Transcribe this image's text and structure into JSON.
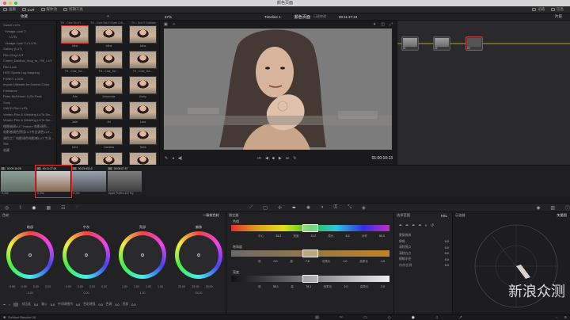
{
  "window_title": "颜色页面",
  "toolbar": {
    "left": [
      "media_label_1",
      "media_label_2",
      "media_label_3",
      "media_label_4"
    ],
    "left_labels": [
      "画廊",
      "LUT",
      "媒体池",
      "剪辑工具"
    ],
    "right_labels": [
      "光箱",
      "信息"
    ]
  },
  "subbar": {
    "media_tree_title": "收藏",
    "zoom": "27%",
    "timeline_name": "Timeline 1",
    "page_title": "颜色页面",
    "page_subtitle": "已经修改",
    "timecode": "00:11:27:24",
    "node_label": "片段"
  },
  "media_tree": [
    "Sweet LUTs",
    "Vintage Look 2",
    "LUTs",
    "Vintage Look 2.2 LUTs",
    "Gallery (LUT)",
    "Film-Vlog LUT",
    "Cinem_DaVinci_Vlog_to_709_LUT",
    "Film Look",
    "HGH Sports Log Mapping",
    "FUNKY LOOK",
    "Impulz Ultimate for Davinci Color",
    "Freelance",
    "Peter McKinnon LUTs Pack",
    "Sony",
    "VMCD Film LUTs",
    "Vimbro Film & Wedding LUTs Ser...",
    "Vimbro Film & Wedding LUTs Ser...",
    "夜晚暗调LUT Yeaven 电影调色...",
    "电影感调色预设LUT专业调色LUT...",
    "调色工厂电影调色电影感LUT 专业...",
    "Site",
    "收藏"
  ],
  "media_grid": {
    "headers": [
      "TH - Cine Sci-Fi ...",
      "TH - Cine Sci-Fi Dark Crit...",
      "TH - Sci-Fi Gotham"
    ],
    "thumbs": [
      "Alina",
      "Alina",
      "Alina",
      "TH - Cine_Sci ...",
      "TH - Cine_Sci ...",
      "TH - Cine_Sci ...",
      "Ada",
      "Anacronia",
      "Avery",
      "Jade",
      "Jet",
      "Lara",
      "Lima",
      "Carolina",
      "Tarek",
      "Fall 80s - Sweet Faded",
      "Ruben",
      "Kaipa"
    ]
  },
  "viewer": {
    "timecode": "01:00:10:13"
  },
  "nodes": [
    "01",
    "02",
    "03"
  ],
  "timeline": {
    "clips": [
      {
        "num": "01",
        "tc": "00:09:16:25",
        "name": "H.264"
      },
      {
        "num": "02",
        "tc": "00:11:27:24",
        "name": "H.264"
      },
      {
        "num": "03",
        "tc": "00:23:43:10",
        "name": "H.264"
      },
      {
        "num": "04",
        "tc": "00:05:07:07",
        "name": "Apple ProRes 422 HQ"
      }
    ]
  },
  "wheels": {
    "panel_title": "色轮",
    "mode_label": "一级校色轮",
    "items": [
      {
        "label": "暗部",
        "values": [
          "0.00",
          "0.00",
          "0.00",
          "0.00"
        ],
        "sub": "-0.00"
      },
      {
        "label": "中灰",
        "values": [
          "0.00",
          "0.00",
          "0.00",
          "0.00"
        ],
        "sub": "0.00"
      },
      {
        "label": "亮部",
        "values": [
          "1.00",
          "1.00",
          "1.00",
          "1.00"
        ],
        "sub": "1.00"
      },
      {
        "label": "偏移",
        "values": [
          "25.00",
          "25.00",
          "25.00",
          ""
        ],
        "sub": "25.00"
      }
    ],
    "footer": [
      "对比度",
      "0.0",
      "轴心",
      "0.0",
      "中间调细节",
      "0.0",
      "色彩增强",
      "0.0",
      "色调",
      "0.0",
      "亮部",
      "0.0"
    ]
  },
  "hsl": {
    "panel_title": "限定器",
    "bars": [
      {
        "label": "色相",
        "vals": [
          "中心",
          "35.2",
          "宽度",
          "11.2",
          "柔化",
          "6.2",
          "对称",
          "50.0"
        ],
        "colors": [
          "#e03030",
          "#e0a020",
          "#e0e020",
          "#30c030",
          "#30c0e0",
          "#3030e0",
          "#c030c0"
        ]
      },
      {
        "label": "饱和度",
        "vals": [
          "低",
          "0.0",
          "高",
          "7.6",
          "低柔化",
          "1.0",
          "高柔化",
          "1.0"
        ],
        "colors": [
          "#6a6a6a",
          "#c38423"
        ]
      },
      {
        "label": "亮度",
        "vals": [
          "低",
          "55.1",
          "高",
          "78.1",
          "低柔化",
          "2.0",
          "高柔化",
          "2.0"
        ],
        "colors": [
          "#111111",
          "#eeeeee"
        ]
      }
    ]
  },
  "qualifier": {
    "title": "选择范围",
    "mode": "HSL",
    "rows": [
      {
        "label": "蒙版微调",
        "value": ""
      },
      {
        "label": "降噪",
        "value": "0.0"
      },
      {
        "label": "清除黑点",
        "value": "0.0"
      },
      {
        "label": "清除白点",
        "value": "0.0"
      },
      {
        "label": "模糊半径",
        "value": "0.0"
      },
      {
        "label": "内/外比例",
        "value": "0.0"
      }
    ]
  },
  "scope": {
    "title": "示波器",
    "mode": "矢量图"
  },
  "watermark": "新浪众测",
  "dock_label": "DaVinci Resolve 16"
}
